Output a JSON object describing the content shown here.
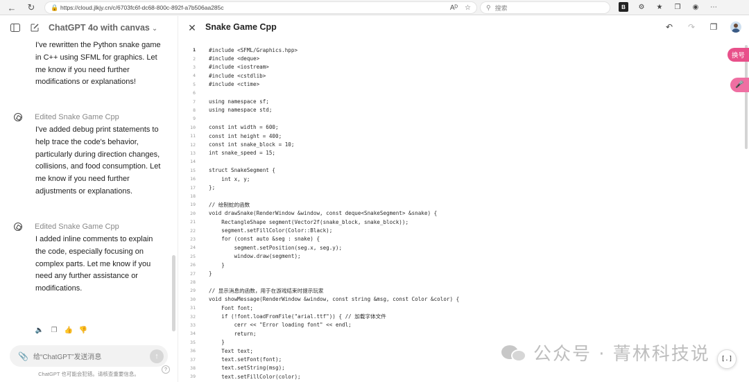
{
  "browser": {
    "url": "https://cloud.jlkjy.cn/c/6703fc6f-dc68-800c-892f-a7b506aa285c",
    "search_placeholder": "搜索"
  },
  "chat": {
    "model_title": "ChatGPT 4o with canvas",
    "messages": [
      {
        "text": "I've rewritten the Python snake game in C++ using SFML for graphics. Let me know if you need further modifications or explanations!"
      },
      {
        "edited": "Edited Snake Game Cpp",
        "text": "I've added debug print statements to help trace the code's behavior, particularly during direction changes, collisions, and food consumption. Let me know if you need further adjustments or explanations."
      },
      {
        "edited": "Edited Snake Game Cpp",
        "text": "I added inline comments to explain the code, especially focusing on complex parts. Let me know if you need any further assistance or modifications."
      }
    ],
    "composer_placeholder": "给“ChatGPT”发送消息",
    "disclaimer": "ChatGPT 也可能会犯错。请核查重要信息。",
    "help": "?"
  },
  "canvas": {
    "title": "Snake Game Cpp",
    "lines": [
      {
        "n": "1",
        "code": "#include <SFML/Graphics.hpp>"
      },
      {
        "n": "2",
        "code": "#include <deque>"
      },
      {
        "n": "3",
        "code": "#include <iostream>"
      },
      {
        "n": "4",
        "code": "#include <cstdlib>"
      },
      {
        "n": "5",
        "code": "#include <ctime>"
      },
      {
        "n": "6",
        "code": ""
      },
      {
        "n": "7",
        "code": "using namespace sf;"
      },
      {
        "n": "8",
        "code": "using namespace std;"
      },
      {
        "n": "9",
        "code": ""
      },
      {
        "n": "10",
        "code": "const int width = 600;"
      },
      {
        "n": "11",
        "code": "const int height = 400;"
      },
      {
        "n": "12",
        "code": "const int snake_block = 10;"
      },
      {
        "n": "13",
        "code": "int snake_speed = 15;"
      },
      {
        "n": "14",
        "code": ""
      },
      {
        "n": "15",
        "code": "struct SnakeSegment {"
      },
      {
        "n": "16",
        "code": "    int x, y;"
      },
      {
        "n": "17",
        "code": "};"
      },
      {
        "n": "18",
        "code": ""
      },
      {
        "n": "19",
        "code": "// 绘制蛇的函数"
      },
      {
        "n": "20",
        "code": "void drawSnake(RenderWindow &window, const deque<SnakeSegment> &snake) {"
      },
      {
        "n": "21",
        "code": "    RectangleShape segment(Vector2f(snake_block, snake_block));"
      },
      {
        "n": "22",
        "code": "    segment.setFillColor(Color::Black);"
      },
      {
        "n": "23",
        "code": "    for (const auto &seg : snake) {"
      },
      {
        "n": "24",
        "code": "        segment.setPosition(seg.x, seg.y);"
      },
      {
        "n": "25",
        "code": "        window.draw(segment);"
      },
      {
        "n": "26",
        "code": "    }"
      },
      {
        "n": "27",
        "code": "}"
      },
      {
        "n": "28",
        "code": ""
      },
      {
        "n": "29",
        "code": "// 显示消息的函数，用于在游戏结束时提示玩家"
      },
      {
        "n": "30",
        "code": "void showMessage(RenderWindow &window, const string &msg, const Color &color) {"
      },
      {
        "n": "31",
        "code": "    Font font;"
      },
      {
        "n": "32",
        "code": "    if (!font.loadFromFile(\"arial.ttf\")) { // 加载字体文件"
      },
      {
        "n": "33",
        "code": "        cerr << \"Error loading font\" << endl;"
      },
      {
        "n": "34",
        "code": "        return;"
      },
      {
        "n": "35",
        "code": "    }"
      },
      {
        "n": "36",
        "code": "    Text text;"
      },
      {
        "n": "37",
        "code": "    text.setFont(font);"
      },
      {
        "n": "38",
        "code": "    text.setString(msg);"
      },
      {
        "n": "39",
        "code": "    text.setFillColor(color);"
      }
    ]
  },
  "overlays": {
    "swap_label": "换号",
    "watermark": "公众号 · 菁林科技说",
    "code_button": "[.]"
  },
  "colors": {
    "swap": "#e8508a",
    "mic": "#ef6fa2"
  }
}
